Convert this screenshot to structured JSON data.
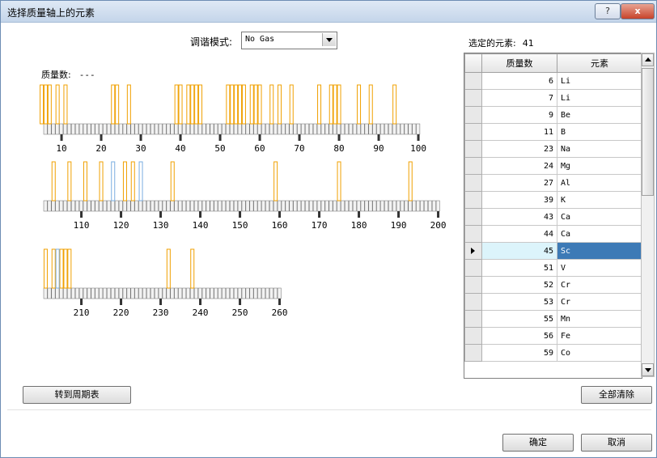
{
  "window": {
    "title": "选择质量轴上的元素",
    "help_label": "?",
    "close_label": "x"
  },
  "mode": {
    "label": "调谐模式:",
    "value": "No Gas"
  },
  "mass_display": {
    "label": "质量数:",
    "value": "---"
  },
  "axes": [
    {
      "start": 6,
      "end": 100,
      "ticks": [
        10,
        20,
        30,
        40,
        50,
        60,
        70,
        80,
        90,
        100
      ],
      "orange": [
        5,
        6,
        7,
        9,
        11,
        23,
        24,
        27,
        39,
        40,
        42,
        43,
        44,
        45,
        52,
        53,
        54,
        55,
        56,
        58,
        59,
        60,
        63,
        65,
        68,
        75,
        78,
        79,
        80,
        85,
        88,
        94
      ],
      "blue": []
    },
    {
      "start": 101,
      "end": 200,
      "ticks": [
        110,
        120,
        130,
        140,
        150,
        160,
        170,
        180,
        190,
        200
      ],
      "orange": [
        103,
        107,
        111,
        115,
        121,
        123,
        133,
        159,
        175,
        193
      ],
      "blue": [
        118,
        125
      ]
    },
    {
      "start": 201,
      "end": 260,
      "ticks": [
        210,
        220,
        230,
        240,
        250,
        260
      ],
      "orange": [
        201,
        203,
        205,
        206,
        207,
        232,
        238
      ],
      "blue": [
        204
      ]
    }
  ],
  "colors": {
    "orange": "#f0a000",
    "blue": "#7aaee0",
    "selected": "#3d7ab6"
  },
  "selection": {
    "label": "选定的元素:",
    "count": "41"
  },
  "table": {
    "headers": {
      "mass": "质量数",
      "element": "元素"
    },
    "selected_index": 10,
    "rows": [
      {
        "mass": "6",
        "element": "Li"
      },
      {
        "mass": "7",
        "element": "Li"
      },
      {
        "mass": "9",
        "element": "Be"
      },
      {
        "mass": "11",
        "element": "B"
      },
      {
        "mass": "23",
        "element": "Na"
      },
      {
        "mass": "24",
        "element": "Mg"
      },
      {
        "mass": "27",
        "element": "Al"
      },
      {
        "mass": "39",
        "element": "K"
      },
      {
        "mass": "43",
        "element": "Ca"
      },
      {
        "mass": "44",
        "element": "Ca"
      },
      {
        "mass": "45",
        "element": "Sc"
      },
      {
        "mass": "51",
        "element": "V"
      },
      {
        "mass": "52",
        "element": "Cr"
      },
      {
        "mass": "53",
        "element": "Cr"
      },
      {
        "mass": "55",
        "element": "Mn"
      },
      {
        "mass": "56",
        "element": "Fe"
      },
      {
        "mass": "59",
        "element": "Co"
      }
    ]
  },
  "buttons": {
    "periodic_table": "转到周期表",
    "clear_all": "全部清除",
    "ok": "确定",
    "cancel": "取消"
  }
}
